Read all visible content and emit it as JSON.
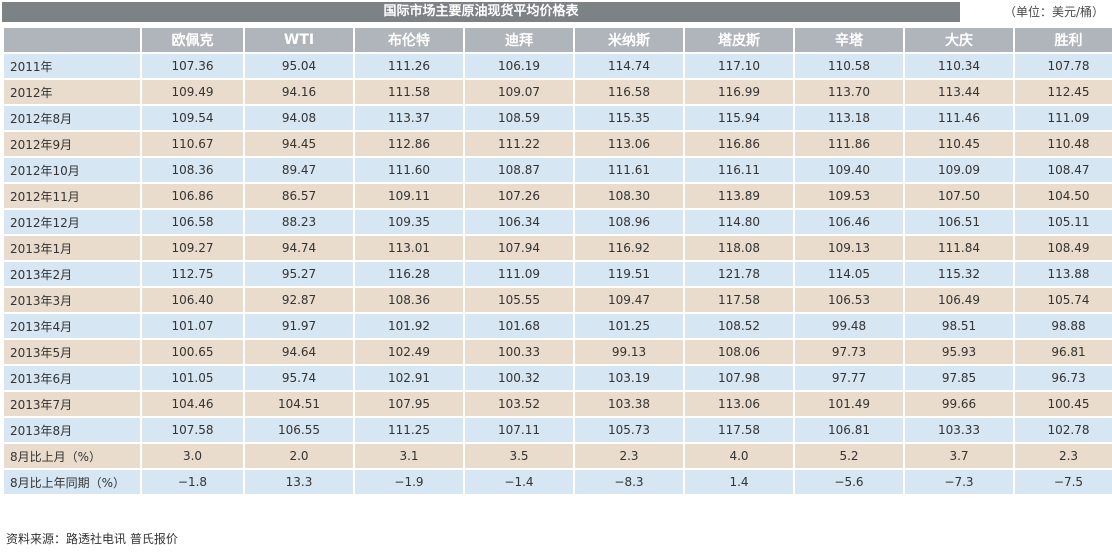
{
  "title": "国际市场主要原油现货平均价格表",
  "unit": "（单位：美元/桶）",
  "columns": [
    "",
    "欧佩克",
    "WTI",
    "布伦特",
    "迪拜",
    "米纳斯",
    "塔皮斯",
    "辛塔",
    "大庆",
    "胜利"
  ],
  "rows": [
    [
      "2011年",
      "107.36",
      "95.04",
      "111.26",
      "106.19",
      "114.74",
      "117.10",
      "110.58",
      "110.34",
      "107.78"
    ],
    [
      "2012年",
      "109.49",
      "94.16",
      "111.58",
      "109.07",
      "116.58",
      "116.99",
      "113.70",
      "113.44",
      "112.45"
    ],
    [
      "2012年8月",
      "109.54",
      "94.08",
      "113.37",
      "108.59",
      "115.35",
      "115.94",
      "113.18",
      "111.46",
      "111.09"
    ],
    [
      "2012年9月",
      "110.67",
      "94.45",
      "112.86",
      "111.22",
      "113.06",
      "116.86",
      "111.86",
      "110.45",
      "110.48"
    ],
    [
      "2012年10月",
      "108.36",
      "89.47",
      "111.60",
      "108.87",
      "111.61",
      "116.11",
      "109.40",
      "109.09",
      "108.47"
    ],
    [
      "2012年11月",
      "106.86",
      "86.57",
      "109.11",
      "107.26",
      "108.30",
      "113.89",
      "109.53",
      "107.50",
      "104.50"
    ],
    [
      "2012年12月",
      "106.58",
      "88.23",
      "109.35",
      "106.34",
      "108.96",
      "114.80",
      "106.46",
      "106.51",
      "105.11"
    ],
    [
      "2013年1月",
      "109.27",
      "94.74",
      "113.01",
      "107.94",
      "116.92",
      "118.08",
      "109.13",
      "111.84",
      "108.49"
    ],
    [
      "2013年2月",
      "112.75",
      "95.27",
      "116.28",
      "111.09",
      "119.51",
      "121.78",
      "114.05",
      "115.32",
      "113.88"
    ],
    [
      "2013年3月",
      "106.40",
      "92.87",
      "108.36",
      "105.55",
      "109.47",
      "117.58",
      "106.53",
      "106.49",
      "105.74"
    ],
    [
      "2013年4月",
      "101.07",
      "91.97",
      "101.92",
      "101.68",
      "101.25",
      "108.52",
      "99.48",
      "98.51",
      "98.88"
    ],
    [
      "2013年5月",
      "100.65",
      "94.64",
      "102.49",
      "100.33",
      "99.13",
      "108.06",
      "97.73",
      "95.93",
      "96.81"
    ],
    [
      "2013年6月",
      "101.05",
      "95.74",
      "102.91",
      "100.32",
      "103.19",
      "107.98",
      "97.77",
      "97.85",
      "96.73"
    ],
    [
      "2013年7月",
      "104.46",
      "104.51",
      "107.95",
      "103.52",
      "103.38",
      "113.06",
      "101.49",
      "99.66",
      "100.45"
    ],
    [
      "2013年8月",
      "107.58",
      "106.55",
      "111.25",
      "107.11",
      "105.73",
      "117.58",
      "106.81",
      "103.33",
      "102.78"
    ],
    [
      "8月比上月（%）",
      "3.0",
      "2.0",
      "3.1",
      "3.5",
      "2.3",
      "4.0",
      "5.2",
      "3.7",
      "2.3"
    ],
    [
      "8月比上年同期（%）",
      "−1.8",
      "13.3",
      "−1.9",
      "−1.4",
      "−8.3",
      "1.4",
      "−5.6",
      "−7.3",
      "−7.5"
    ]
  ],
  "source": "资料来源：路透社电讯  普氏报价",
  "colors": {
    "title_bg": "#7d8287",
    "header_bg": "#b0b5bb",
    "row_blue": "#d6e6f2",
    "row_beige": "#e9dccc"
  }
}
